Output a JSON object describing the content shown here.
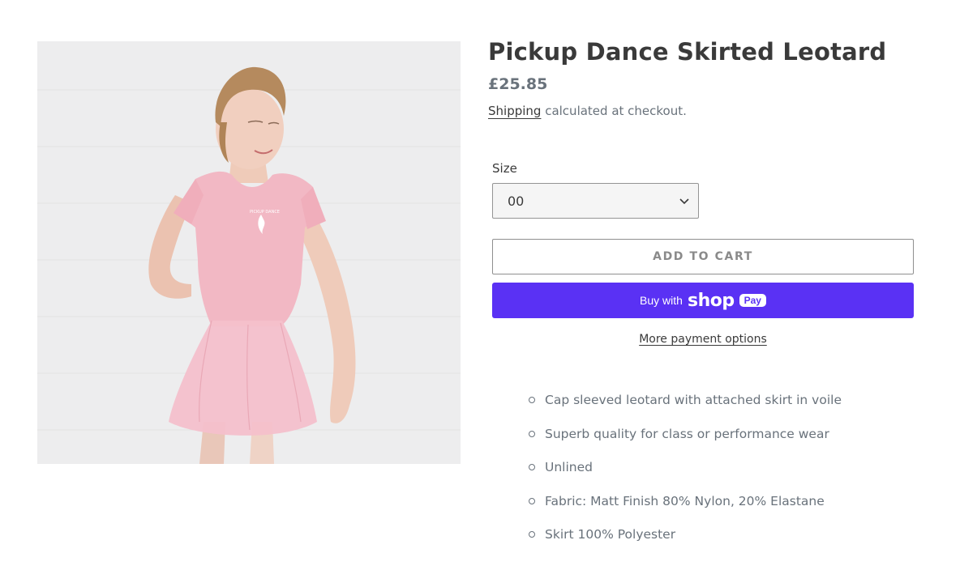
{
  "product": {
    "title": "Pickup Dance Skirted Leotard",
    "price": "£25.85",
    "shipping_link": "Shipping",
    "shipping_suffix": " calculated at checkout.",
    "image_logo_text": "PICKUP DANCE"
  },
  "variant": {
    "label": "Size",
    "selected": "00"
  },
  "actions": {
    "add_to_cart": "ADD TO CART",
    "shop_pay_prefix": "Buy with",
    "shop_pay_brand": "shop",
    "shop_pay_pill": "Pay",
    "more_options": "More payment options"
  },
  "features": [
    "Cap sleeved leotard with attached skirt in voile",
    "Superb quality for class or performance wear",
    "Unlined",
    "Fabric: Matt Finish 80% Nylon, 20% Elastane",
    "Skirt 100% Polyester"
  ],
  "colors": {
    "accent_shop_pay": "#5a31f4",
    "leotard_pink": "#f0b4c0",
    "text_dark": "#3a3a3a",
    "text_muted": "#69727b"
  }
}
